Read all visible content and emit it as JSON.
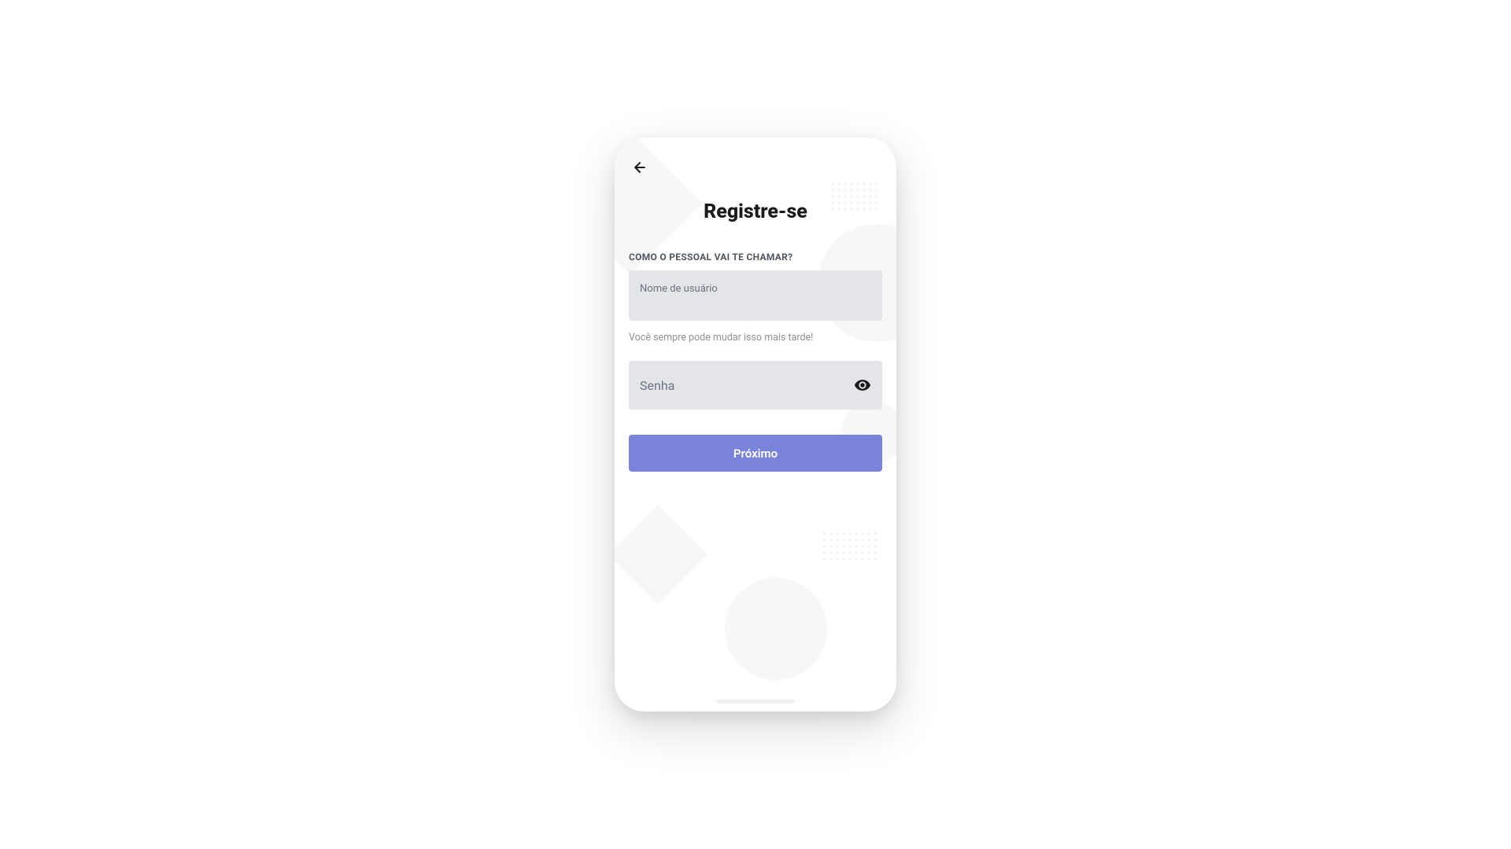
{
  "header": {
    "title": "Registre-se"
  },
  "form": {
    "username": {
      "label": "COMO O PESSOAL VAI TE CHAMAR?",
      "placeholder": "Nome de usuário",
      "hint": "Você sempre pode mudar isso mais tarde!"
    },
    "password": {
      "placeholder": "Senha"
    },
    "submit_label": "Próximo"
  },
  "icons": {
    "back": "arrow-left-icon",
    "eye": "eye-icon"
  },
  "colors": {
    "primary_button": "#7983d9",
    "input_bg": "#e3e5e8",
    "label_text": "#4f5660",
    "hint_text": "#8e9297",
    "title_text": "#1a1a1a"
  }
}
